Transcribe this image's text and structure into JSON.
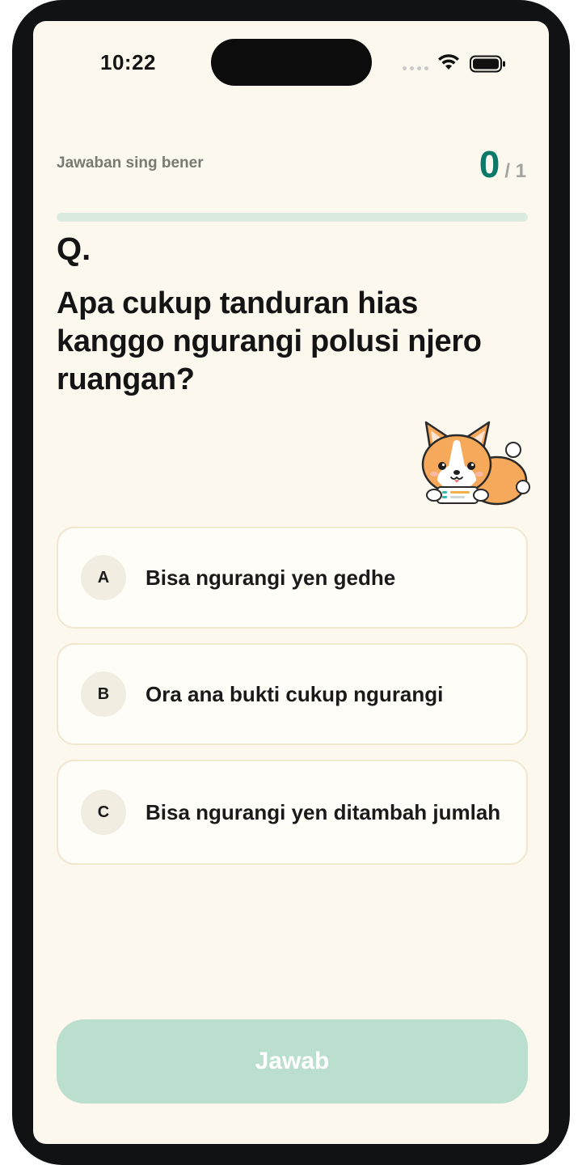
{
  "status_bar": {
    "time": "10:22",
    "icons": [
      "signal-dots-icon",
      "wifi-icon",
      "battery-icon"
    ]
  },
  "score": {
    "label": "Jawaban sing bener",
    "current": "0",
    "total": "/ 1",
    "progress_fraction": 0
  },
  "question": {
    "marker": "Q.",
    "text": "Apa cukup tanduran hias kanggo ngurangi polusi njero ruangan?"
  },
  "mascot": {
    "icon": "corgi-mascot-icon"
  },
  "options": [
    {
      "letter": "A",
      "text": "Bisa ngurangi yen gedhe"
    },
    {
      "letter": "B",
      "text": "Ora ana bukti cukup ngurangi"
    },
    {
      "letter": "C",
      "text": "Bisa ngurangi yen ditambah jumlah"
    }
  ],
  "submit": {
    "label": "Jawab",
    "enabled": false
  },
  "colors": {
    "background": "#fdf8ee",
    "accent": "#0b7a6a",
    "button_disabled": "#bbdfcf",
    "progress_track": "#dcebe0",
    "option_border": "#f1e7cf"
  }
}
